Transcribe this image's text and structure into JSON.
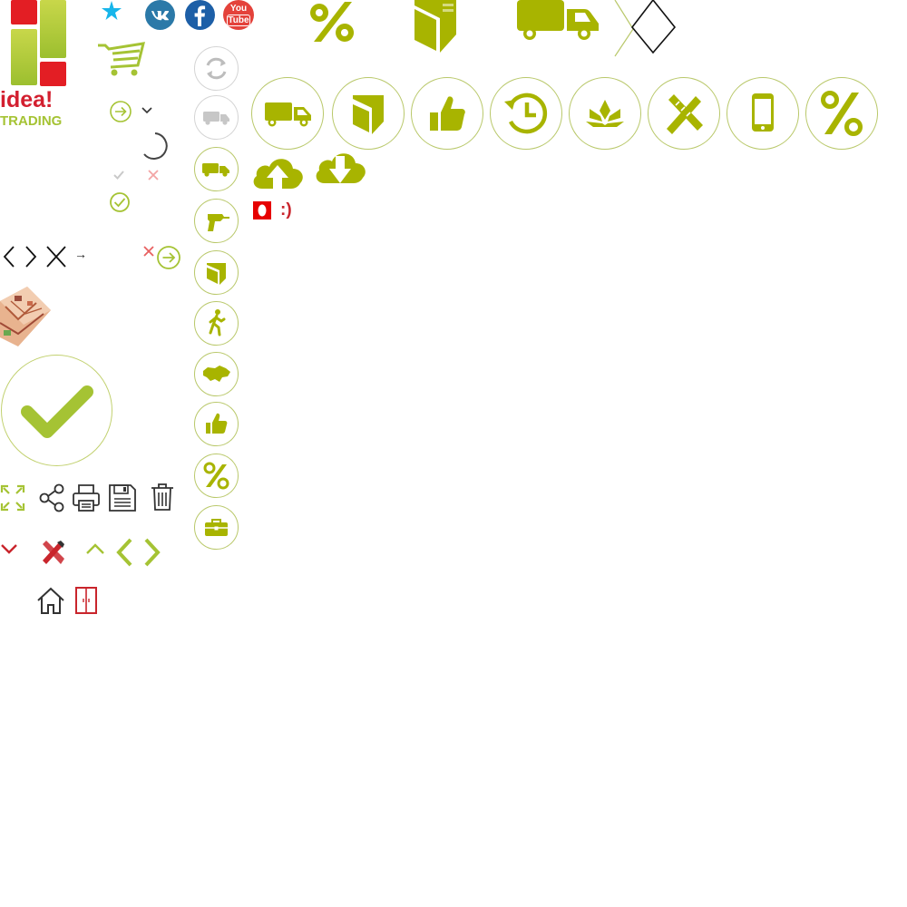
{
  "logo": {
    "word": "idea!",
    "subword": "TRADING"
  },
  "social": {
    "vk": "vk-icon",
    "facebook": "facebook-icon",
    "youtube_line1": "You",
    "youtube_line2": "Tube"
  },
  "emoticon": ":)",
  "arrow_glyph": "→",
  "colors": {
    "olive": "#a8b400",
    "olive_light": "#b9c86a",
    "lime": "#a5c334",
    "red": "#d31f2f",
    "vk_blue": "#2b79a8",
    "fb_blue": "#1d5fa7",
    "yt_red": "#e4423b",
    "star_blue": "#17b5ea",
    "gray": "#b3b3b3"
  }
}
